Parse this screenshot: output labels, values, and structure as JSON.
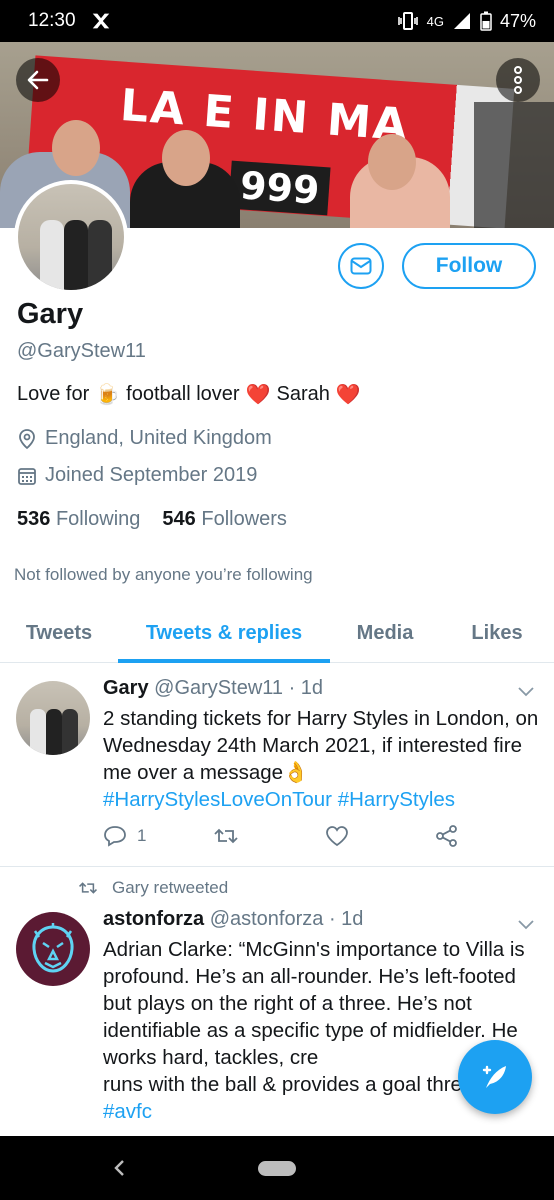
{
  "status_bar": {
    "time": "12:30",
    "network": "4G",
    "battery": "47%",
    "icons": [
      "notification-icon",
      "vibrate-icon",
      "signal-icon",
      "battery-icon"
    ]
  },
  "banner": {
    "flag_text": "LA  E IN MA",
    "flag_number": "999"
  },
  "profile": {
    "name": "Gary",
    "handle": "@GaryStew11",
    "bio": {
      "part1": "Love for",
      "emoji1": "🍺",
      "part2": "football lover",
      "emoji2": "❤️",
      "part3": "Sarah",
      "emoji3": "❤️"
    },
    "location": "England, United Kingdom",
    "joined": "Joined September 2019",
    "following_count": "536",
    "following_label": "Following",
    "followers_count": "546",
    "followers_label": "Followers",
    "not_followed_text": "Not followed by anyone you’re following",
    "follow_label": "Follow"
  },
  "tabs": [
    {
      "label": "Tweets"
    },
    {
      "label": "Tweets & replies",
      "selected": true
    },
    {
      "label": "Media"
    },
    {
      "label": "Likes"
    }
  ],
  "tweets": [
    {
      "author": "Gary",
      "handle": "@GaryStew11",
      "time": "· 1d",
      "text": "2 standing tickets for Harry Styles in London, on Wednesday 24th March 2021, if interested fire me over a message👌",
      "hashtags": "#HarryStylesLoveOnTour #HarryStyles",
      "reply_count": "1"
    },
    {
      "retweeted_by": "Gary retweeted",
      "author": "astonforza",
      "handle": "@astonforza",
      "time": "· 1d",
      "text": "Adrian Clarke: “McGinn's importance to Villa is profound. He’s an all-rounder. He’s left-footed but plays on the right of a three. He’s not identifiable as a specific type of midfielder. He works hard, tackles, cre",
      "text_end": "runs with the ball & provides a goal threat.” [pl]",
      "hashtag": "#avfc"
    }
  ],
  "colors": {
    "accent": "#1da1f2",
    "text": "#14171a",
    "secondary": "#657786",
    "divider": "#e1e8ed"
  }
}
